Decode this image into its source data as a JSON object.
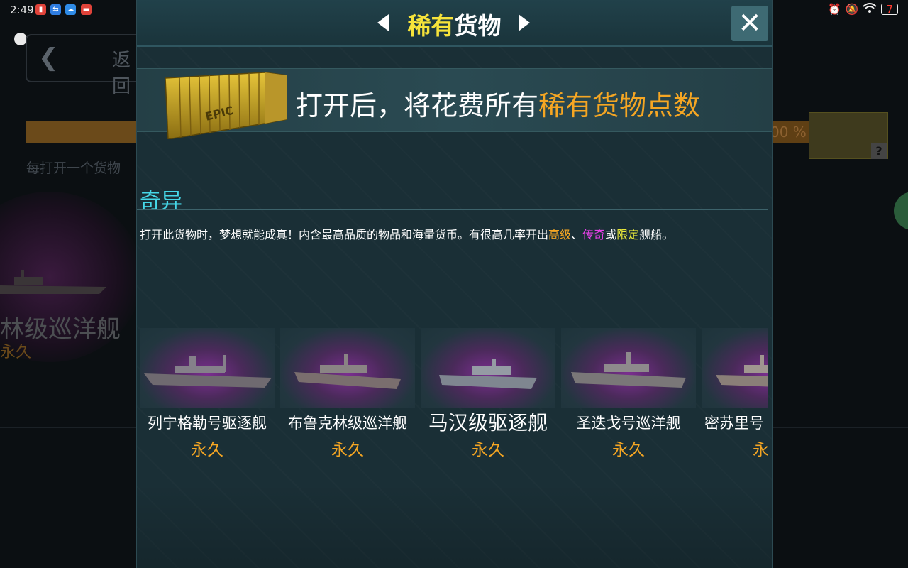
{
  "status_bar": {
    "time": "2:49",
    "battery": "7"
  },
  "background": {
    "back_label": "返回",
    "hint": "每打开一个货物",
    "ship_name": "林级巡洋舰",
    "ship_status": "永久",
    "progress_text": "00 %"
  },
  "modal": {
    "title_highlight": "稀有",
    "title_rest": "货物",
    "crate_label": "EPIC",
    "banner_prefix": "打开后，将花费所有",
    "banner_highlight": "稀有货物点数",
    "section_title": "奇异",
    "description": {
      "part1": "打开此货物时，梦想就能成真！内含最高品质的物品和海量货币。有很高几率开出",
      "tier_high": "高级",
      "sep1": "、",
      "tier_legend": "传奇",
      "sep2": "或",
      "tier_limited": "限定",
      "part2": "舰船。"
    },
    "ships": [
      {
        "name": "列宁格勒号驱逐舰",
        "status": "永久"
      },
      {
        "name": "布鲁克林级巡洋舰",
        "status": "永久"
      },
      {
        "name": "马汉级驱逐舰",
        "status": "永久"
      },
      {
        "name": "圣迭戈号巡洋舰",
        "status": "永久"
      },
      {
        "name": "密苏里号",
        "status": "永久"
      }
    ]
  },
  "colors": {
    "accent_orange": "#f5a623",
    "title_yellow": "#f6e33a",
    "section_cyan": "#46d8e8",
    "legendary_pink": "#e640e8",
    "limited_yellow": "#e8e83a"
  }
}
